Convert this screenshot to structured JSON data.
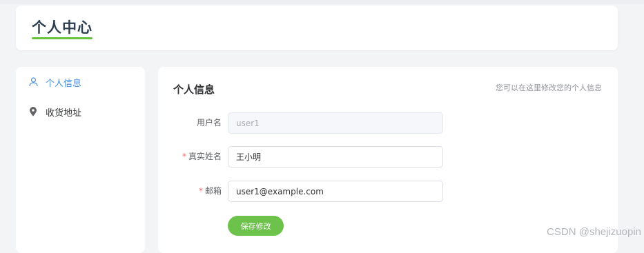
{
  "header": {
    "title": "个人中心"
  },
  "sidebar": {
    "items": [
      {
        "label": "个人信息",
        "icon": "user-icon",
        "active": true
      },
      {
        "label": "收货地址",
        "icon": "location-pin-icon",
        "active": false
      }
    ]
  },
  "main": {
    "title": "个人信息",
    "hint": "您可以在这里修改您的个人信息",
    "fields": {
      "username": {
        "label": "用户名",
        "value": "user1",
        "required": false,
        "disabled": true
      },
      "real_name": {
        "label": "真实姓名",
        "value": "王小明",
        "required": true,
        "disabled": false
      },
      "email": {
        "label": "邮箱",
        "value": "user1@example.com",
        "required": true,
        "disabled": false
      }
    },
    "required_mark": "*",
    "save_label": "保存修改"
  },
  "watermark": "CSDN @shejizuopin",
  "colors": {
    "accent": "#67c23a",
    "active_link": "#4a90e2",
    "required": "#f56c6c"
  }
}
